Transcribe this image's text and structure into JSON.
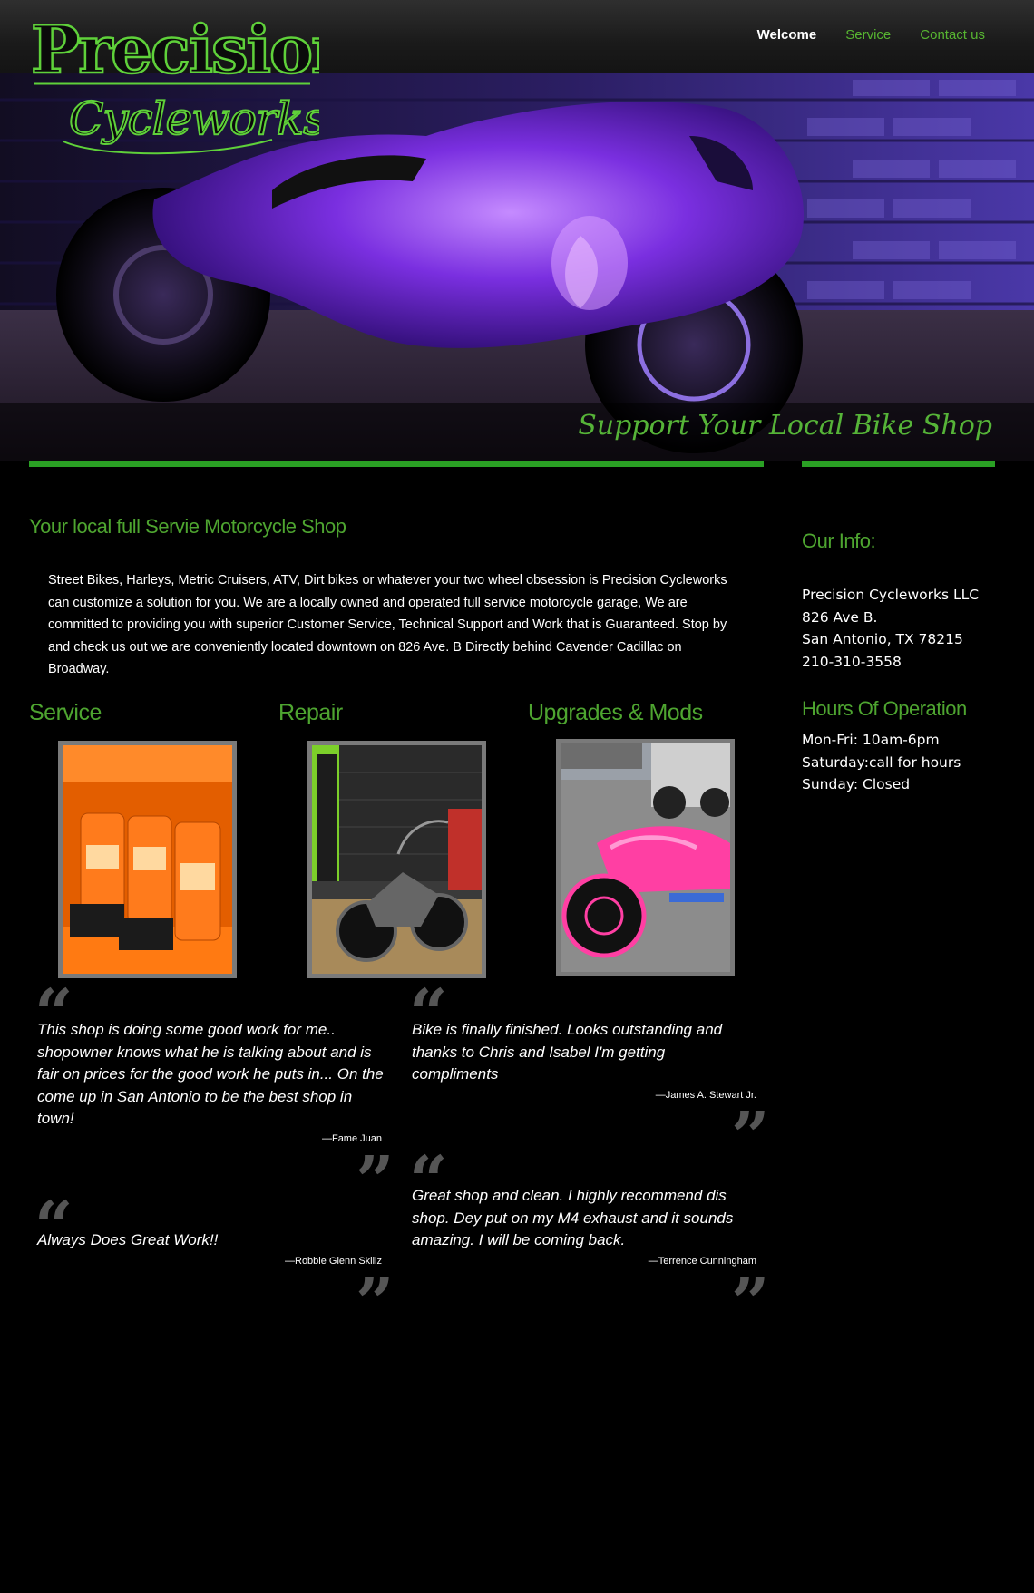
{
  "nav": {
    "items": [
      {
        "label": "Welcome"
      },
      {
        "label": "Service"
      },
      {
        "label": "Contact us"
      }
    ]
  },
  "brand": {
    "logo_line1": "Precision",
    "logo_line2": "Cycleworks",
    "accent_color": "#4ea530"
  },
  "hero": {
    "tagline": "Support Your Local Bike Shop"
  },
  "main": {
    "heading": "Your local full Servie Motorcycle Shop",
    "intro": "Street Bikes, Harleys, Metric Cruisers, ATV, Dirt bikes or whatever your two wheel obsession is Precision Cycleworks can customize a solution for you. We are a locally owned and operated full service motorcycle garage, We are committed to providing you with superior Customer Service, Technical Support and Work that is Guaranteed. Stop by and check us out we are conveniently located downtown on 826 Ave. B Directly behind Cavender Cadillac on Broadway.",
    "columns": [
      {
        "title": "Service"
      },
      {
        "title": "Repair"
      },
      {
        "title": "Upgrades & Mods"
      }
    ]
  },
  "testimonials": [
    {
      "text": "This shop is doing some good work for me.. shopowner knows what he is talking about and is fair on prices for the good work he puts in... On the come up in San Antonio to be the best shop in town!",
      "author": "—Fame Juan"
    },
    {
      "text": "Bike is finally finished. Looks outstanding and thanks to Chris and Isabel I'm getting compliments",
      "author": "—James A. Stewart Jr."
    },
    {
      "text": "Always Does Great Work!!",
      "author": "—Robbie Glenn Skillz"
    },
    {
      "text": "Great shop and clean. I highly recommend dis shop. Dey put on my M4 exhaust and it sounds amazing. I will be coming back.",
      "author": "—Terrence Cunningham"
    }
  ],
  "sidebar": {
    "info_heading": "Our Info:",
    "info_lines": [
      "Precision Cycleworks LLC",
      "826 Ave B.",
      "San Antonio, TX 78215",
      "210-310-3558"
    ],
    "hours_heading": "Hours Of Operation",
    "hours_lines": [
      "Mon-Fri: 10am-6pm",
      "Saturday:call for hours",
      "Sunday: Closed"
    ]
  },
  "icons": {
    "open_quote": "“",
    "close_quote": "”"
  }
}
